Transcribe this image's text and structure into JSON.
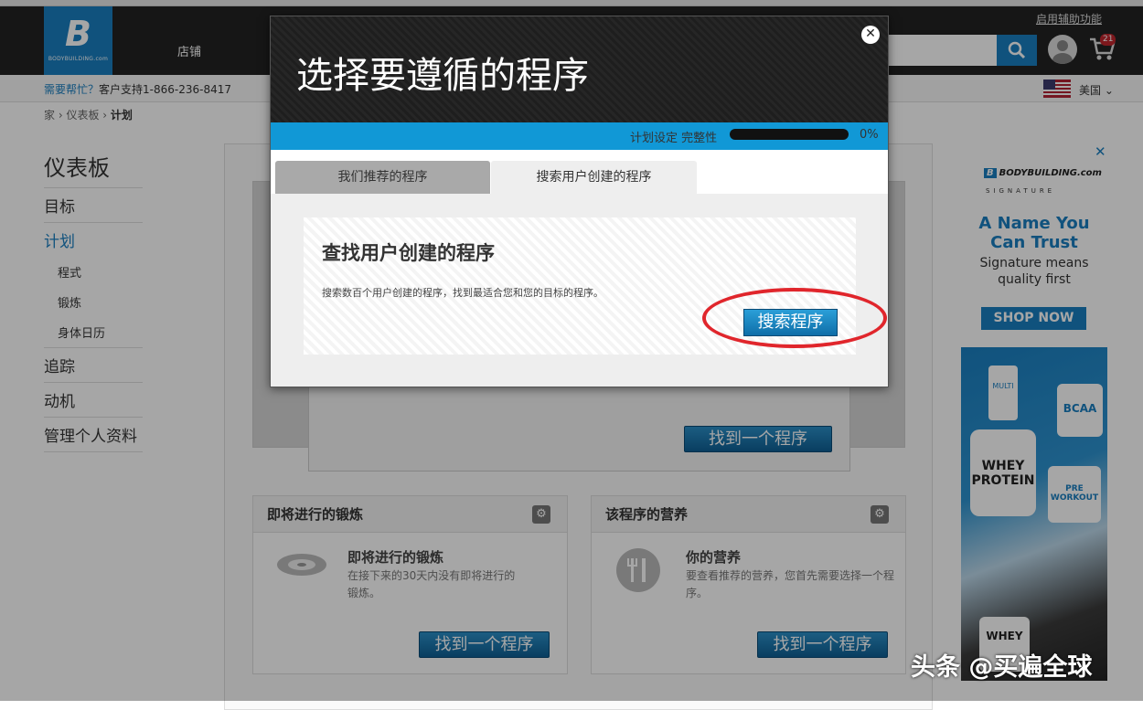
{
  "header": {
    "logo_text": "BODYBUILDING.com",
    "nav_store": "店铺",
    "accessibility": "启用辅助功能",
    "cart_count": "21"
  },
  "subbar": {
    "help_question": "需要帮忙？",
    "help_support": "客户支持1-866-236-8417",
    "country": "美国"
  },
  "breadcrumb": {
    "home": "家",
    "sep": " › ",
    "dashboard": "仪表板",
    "current": "计划"
  },
  "sidebar": {
    "heading": "仪表板",
    "items": [
      "目标",
      "计划",
      "追踪",
      "动机",
      "管理个人资料"
    ],
    "sub_items": [
      "程式",
      "锻炼",
      "身体日历"
    ]
  },
  "main": {
    "hero_button": "找到一个程序",
    "panels": [
      {
        "title": "即将进行的锻炼",
        "heading": "即将进行的锻炼",
        "desc": "在接下来的30天内没有即将进行的锻炼。",
        "button": "找到一个程序"
      },
      {
        "title": "该程序的营养",
        "heading": "你的营养",
        "desc": "要查看推荐的营养，您首先需要选择一个程序。",
        "button": "找到一个程序"
      }
    ]
  },
  "ad": {
    "close": "✕",
    "logo": "BODYBUILDING.com",
    "signature": "SIGNATURE",
    "headline": "A Name You Can Trust",
    "sub": "Signature means quality first",
    "button": "SHOP NOW",
    "product_labels": [
      "MULTI",
      "BCAA",
      "WHEY PROTEIN",
      "PRE WORKOUT",
      "WHEY"
    ]
  },
  "modal": {
    "title": "选择要遵循的程序",
    "close": "✕",
    "progress_label": "计划设定 完整性",
    "progress_pct": "0%",
    "progress_value": 0,
    "tabs": [
      "我们推荐的程序",
      "搜索用户创建的程序"
    ],
    "active_tab": 1,
    "heading": "查找用户创建的程序",
    "desc": "搜索数百个用户创建的程序，找到最适合您和您的目标的程序。",
    "button": "搜索程序"
  },
  "watermark": "头条 @买遍全球"
}
